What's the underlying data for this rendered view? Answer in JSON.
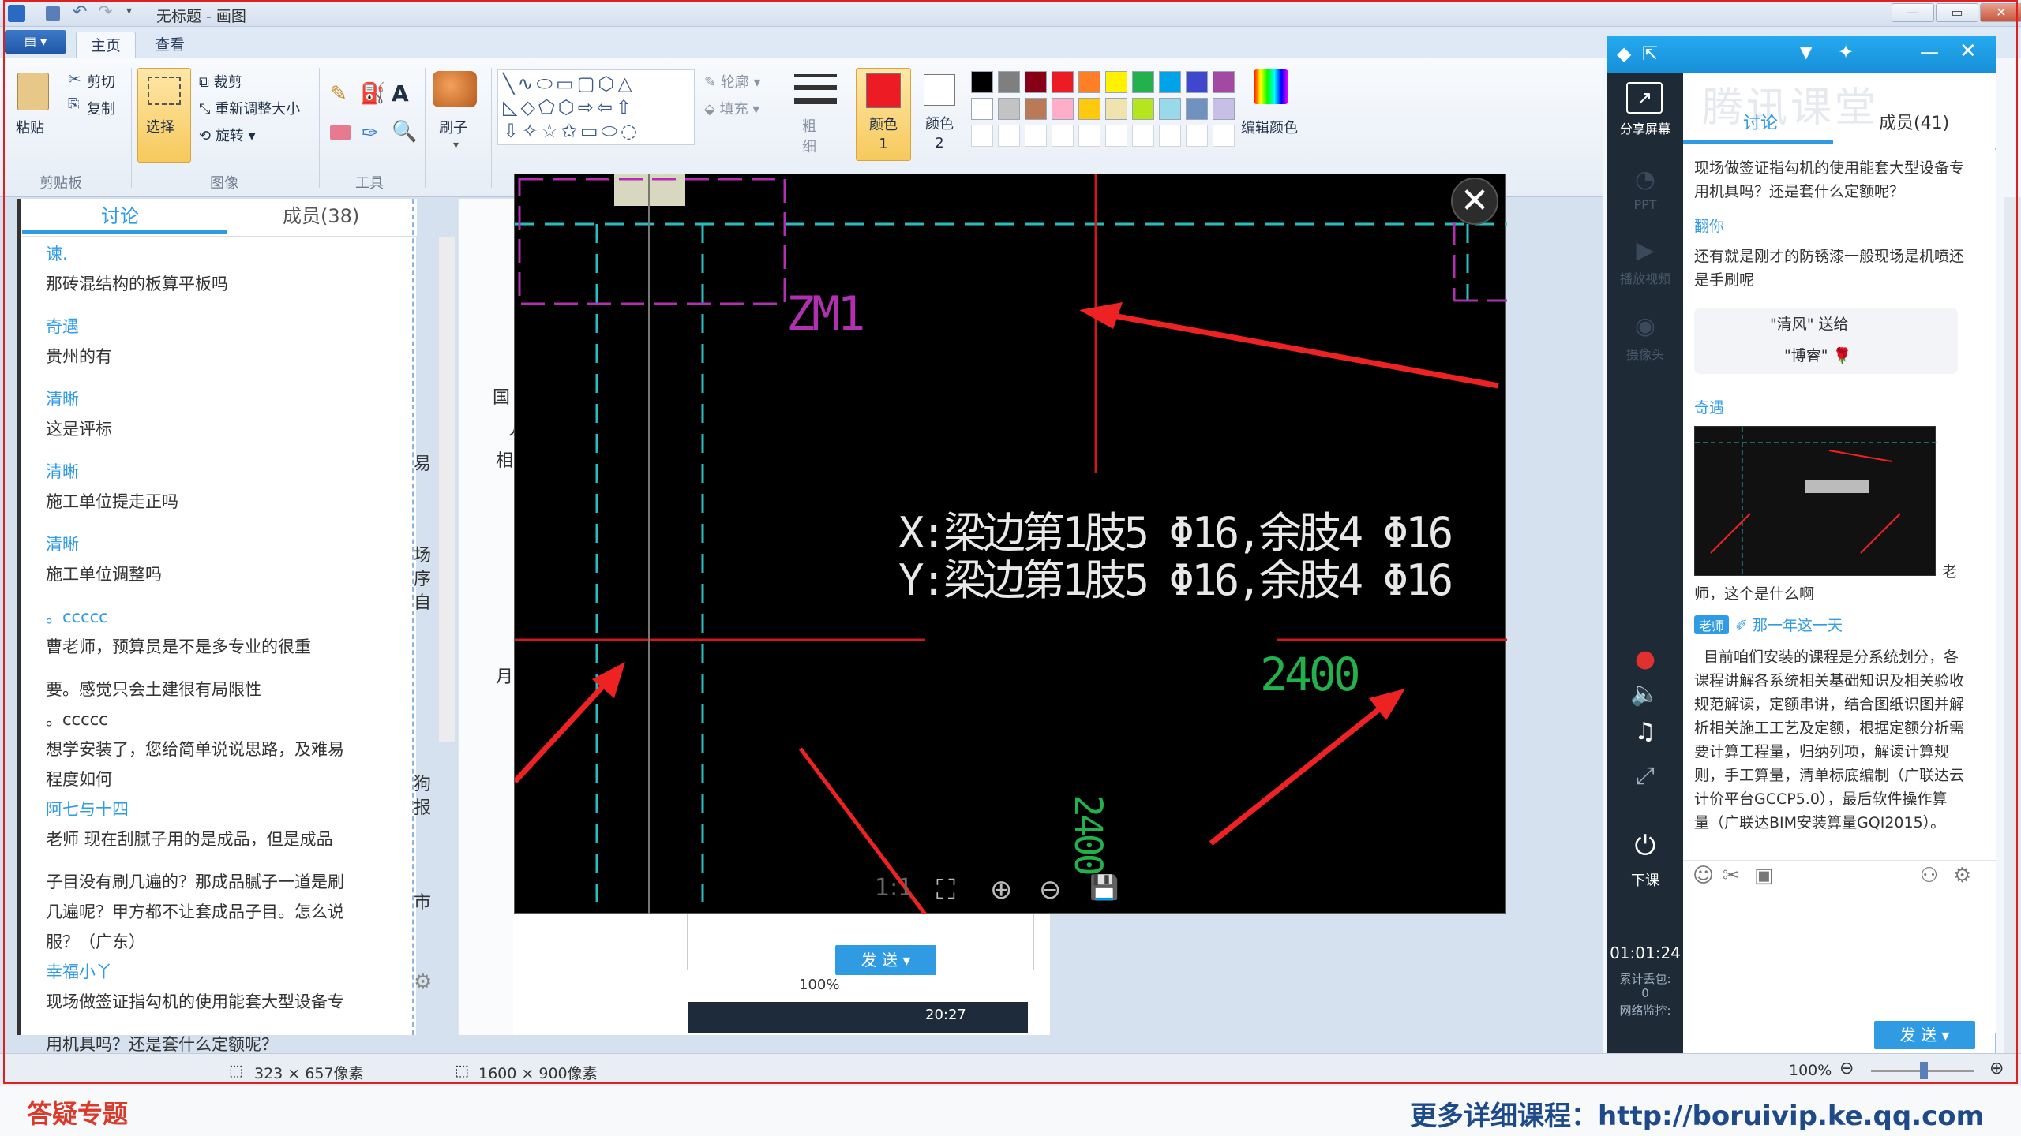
{
  "window": {
    "title": "无标题 - 画图",
    "min": "—",
    "max": "▭",
    "close": "✕"
  },
  "ribbon": {
    "file_btn": "▤ ▾",
    "tabs": [
      "主页",
      "查看"
    ],
    "clipboard": {
      "paste": "粘贴",
      "cut": "剪切",
      "copy": "复制",
      "group": "剪贴板"
    },
    "image": {
      "select": "选择",
      "crop": "裁剪",
      "resize": "重新调整大小",
      "rotate": "旋转",
      "group": "图像"
    },
    "tools": {
      "group": "工具"
    },
    "brush": "刷子",
    "shapes": {
      "outline": "轮廓",
      "fill": "填充",
      "group": "形状"
    },
    "size": "粗细",
    "color1": "颜色 1",
    "color2": "颜色 2",
    "edit_colors": "编辑颜色",
    "group_colors": "颜色"
  },
  "palette": [
    "#000000",
    "#7f7f7f",
    "#880015",
    "#ed1c24",
    "#ff7f27",
    "#fff200",
    "#22b14c",
    "#00a2e8",
    "#3f48cc",
    "#a349a4",
    "#ffffff",
    "#c3c3c3",
    "#b97a57",
    "#ffaec9",
    "#ffc90e",
    "#efe4b0",
    "#b5e61d",
    "#99d9ea",
    "#7092be",
    "#c8bfe7"
  ],
  "left_panel": {
    "tab_discuss": "讨论",
    "tab_members": "成员(38)",
    "messages": [
      {
        "name": "谏.",
        "text": "那砖混结构的板算平板吗"
      },
      {
        "name": "奇遇",
        "text": "贵州的有"
      },
      {
        "name": "清晰",
        "text": "这是评标"
      },
      {
        "name": "清晰",
        "text": "施工单位提走正吗"
      },
      {
        "name": "清晰",
        "text": "施工单位调整吗"
      },
      {
        "name": "。ccccc",
        "text": "曹老师，预算员是不是多专业的很重"
      },
      {
        "name": "",
        "text": "要。感觉只会土建很有局限性"
      },
      {
        "name": "",
        "text": "。ccccc"
      },
      {
        "name": "",
        "text": "想学安装了，您给简单说说思路，及难易"
      },
      {
        "name": "",
        "text": "程度如何"
      },
      {
        "name": "阿七与十四",
        "text": "老师 现在刮腻子用的是成品，但是成品"
      },
      {
        "name": "",
        "text": "子目没有刷几遍的？那成品腻子一道是刷"
      },
      {
        "name": "",
        "text": "几遍呢？甲方都不让套成品子目。怎么说"
      },
      {
        "name": "",
        "text": "服？（广东）"
      },
      {
        "name": "幸福小丫",
        "text": "现场做签证指勾机的使用能套大型设备专"
      },
      {
        "name": "",
        "text": "用机具吗？还是套什么定额呢？"
      }
    ]
  },
  "behind": {
    "chars": [
      "国",
      "丿",
      "相",
      "易",
      "场",
      "序",
      "自",
      "月",
      "狗",
      "报",
      "市"
    ],
    "send": "发 送",
    "zoom": "100%",
    "time": "20:27"
  },
  "viewer": {
    "label_zm": "ZM1",
    "line1": "X:梁边第1肢5 Φ16,余肢4 Φ16",
    "line2": "Y:梁边第1肢5 Φ16,余肢4 Φ16",
    "dim1": "2400",
    "dim2": "2400",
    "toolbar": [
      "1:1",
      "⛶",
      "⊕",
      "⊖",
      "💾"
    ],
    "close": "✕"
  },
  "tencent": {
    "logo": "腾讯课堂",
    "tab_discuss": "讨论",
    "tab_members": "成员(41)",
    "side": [
      "分享屏幕",
      "PPT",
      "播放视频",
      "摄像头",
      "下课"
    ],
    "time": "01:01:24",
    "stats": [
      "累计丢包:",
      "0",
      "网络监控:"
    ],
    "msgs": [
      {
        "t": "现场做签证指勾机的使用能套大型设备专"
      },
      {
        "t": "用机具吗？还是套什么定额呢？"
      },
      {
        "n": "翻你"
      },
      {
        "t": "还有就是刚才的防锈漆一般现场是机喷还"
      },
      {
        "t": "是手刷呢"
      }
    ],
    "gift1": "\"清风\" 送给",
    "gift2": "\"博睿\" 🌹",
    "img_sender": "奇遇",
    "img_caption1": "老",
    "img_caption2": "师，这个是什么啊",
    "teacher_badge": "老师",
    "teacher_name": "✐ 那一年这一天",
    "teacher_msg": [
      "目前咱们安装的课程是分系统划分，各",
      "课程讲解各系统相关基础知识及相关验收",
      "规范解读，定额串讲，结合图纸识图并解",
      "析相关施工工艺及定额，根据定额分析需",
      "要计算工程量，归纳列项，解读计算规",
      "则，手工算量，清单标底编制（广联达云",
      "计价平台GCCP5.0），最后软件操作算",
      "量（广联达BIM安装算量GQI2015）。"
    ],
    "send": "发 送"
  },
  "status": {
    "sel": "323 × 657像素",
    "canvas": "1600 × 900像素",
    "zoom": "100%"
  },
  "footer": {
    "left": "答疑专题",
    "right": "更多详细课程：http://boruivip.ke.qq.com"
  }
}
